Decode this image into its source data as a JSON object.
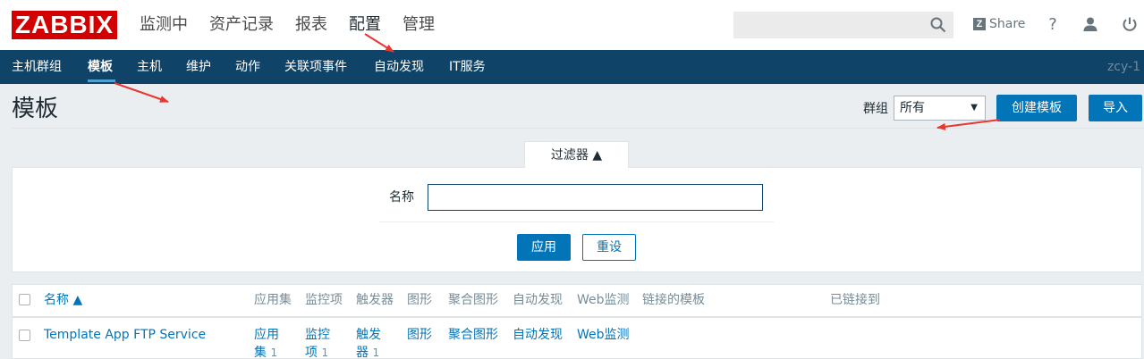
{
  "header": {
    "logo": "ZABBIX",
    "menu": [
      "监测中",
      "资产记录",
      "报表",
      "配置",
      "管理"
    ],
    "share_label": "Share",
    "help_label": "?",
    "icons": [
      "search-icon",
      "share-icon",
      "help-icon",
      "user-icon",
      "power-icon"
    ]
  },
  "submenu": {
    "items": [
      "主机群组",
      "模板",
      "主机",
      "维护",
      "动作",
      "关联项事件",
      "自动发现",
      "IT服务"
    ],
    "user": "zcy-1"
  },
  "page": {
    "title": "模板",
    "group_label": "群组",
    "group_value": "所有",
    "create_button": "创建模板",
    "import_button": "导入"
  },
  "filter": {
    "tab_label": "过滤器 ▲",
    "name_label": "名称",
    "name_value": "",
    "apply_button": "应用",
    "reset_button": "重设"
  },
  "table": {
    "headers": {
      "name": "名称 ▲",
      "applications": "应用集",
      "items": "监控项",
      "triggers": "触发器",
      "graphs": "图形",
      "screens": "聚合图形",
      "discovery": "自动发现",
      "web": "Web监测",
      "linked_templates": "链接的模板",
      "linked_to": "已链接到"
    },
    "rows": [
      {
        "name": "Template App FTP Service",
        "applications_a": "应用",
        "applications_b": "集",
        "applications_count": "1",
        "items_a": "监控",
        "items_b": "项",
        "items_count": "1",
        "triggers_a": "触发",
        "triggers_b": "器",
        "triggers_count": "1",
        "graphs": "图形",
        "screens": "聚合图形",
        "discovery": "自动发现",
        "web": "Web监测"
      }
    ]
  },
  "colors": {
    "logo_red": "#d40000",
    "nav_blue": "#0f4367",
    "accent_blue": "#0275b8",
    "annotation_red": "#e8372f"
  }
}
